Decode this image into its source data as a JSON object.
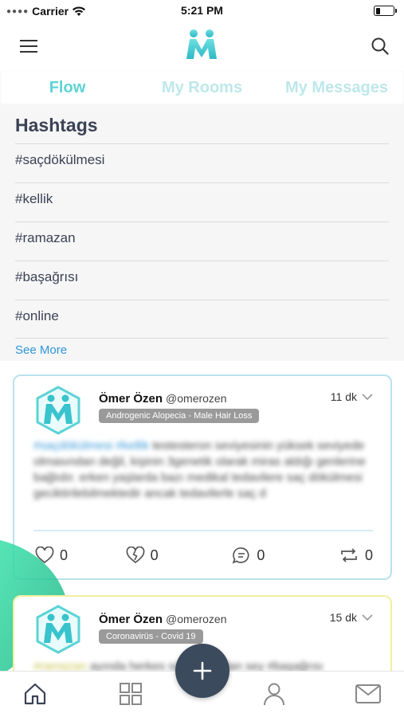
{
  "status_bar": {
    "carrier": "Carrier",
    "time": "5:21 PM",
    "battery_level": 0.25
  },
  "header": {
    "menu_icon": "hamburger-menu-icon",
    "logo": "app-logo",
    "search_icon": "search-icon"
  },
  "tabs": [
    {
      "label": "Flow",
      "active": true
    },
    {
      "label": "My Rooms",
      "active": false
    },
    {
      "label": "My Messages",
      "active": false
    }
  ],
  "hashtags": {
    "title": "Hashtags",
    "items": [
      "#saçdökülmesi",
      "#kellik",
      "#ramazan",
      "#başağrısı",
      "#online"
    ],
    "see_more": "See More"
  },
  "posts": [
    {
      "author": "Ömer Özen",
      "handle": "@omerozen",
      "topic": "Androgenic Alopecia - Male Hair Loss",
      "time": "11 dk",
      "body": {
        "tags": "#saçdökülmesi #kellik",
        "text": " testesteron seviyesinin yüksek seviyede olmasından değil, kişinin 3genetik olarak miras aldığı genlerine bağlıdır. erken yaşlarda bazı medikal tedavilere saç dökülmesi geciktirilebilmektedir ancak tedavilerle saç d"
      },
      "likes": "0",
      "dislikes": "0",
      "comments": "0",
      "reposts": "0",
      "border_color": "#b9e1ee"
    },
    {
      "author": "Ömer Özen",
      "handle": "@omerozen",
      "topic": "Coronavirüs - Covid 19",
      "time": "15 dk",
      "body": {
        "tags": "#ramazan",
        "text": " ayında herkes sık rastlanılan sey #başağrısı"
      },
      "border_color": "#f3ef9d"
    }
  ],
  "bottom_nav": {
    "items": [
      "home-icon",
      "grid-icon",
      "profile-icon",
      "mail-icon"
    ],
    "fab": "plus-icon"
  },
  "colors": {
    "accent": "#5dd3d6",
    "tab_inactive": "#bde8ea",
    "link": "#2e96d8",
    "fab": "#3b4a5c",
    "text_dark": "#3b4256"
  }
}
